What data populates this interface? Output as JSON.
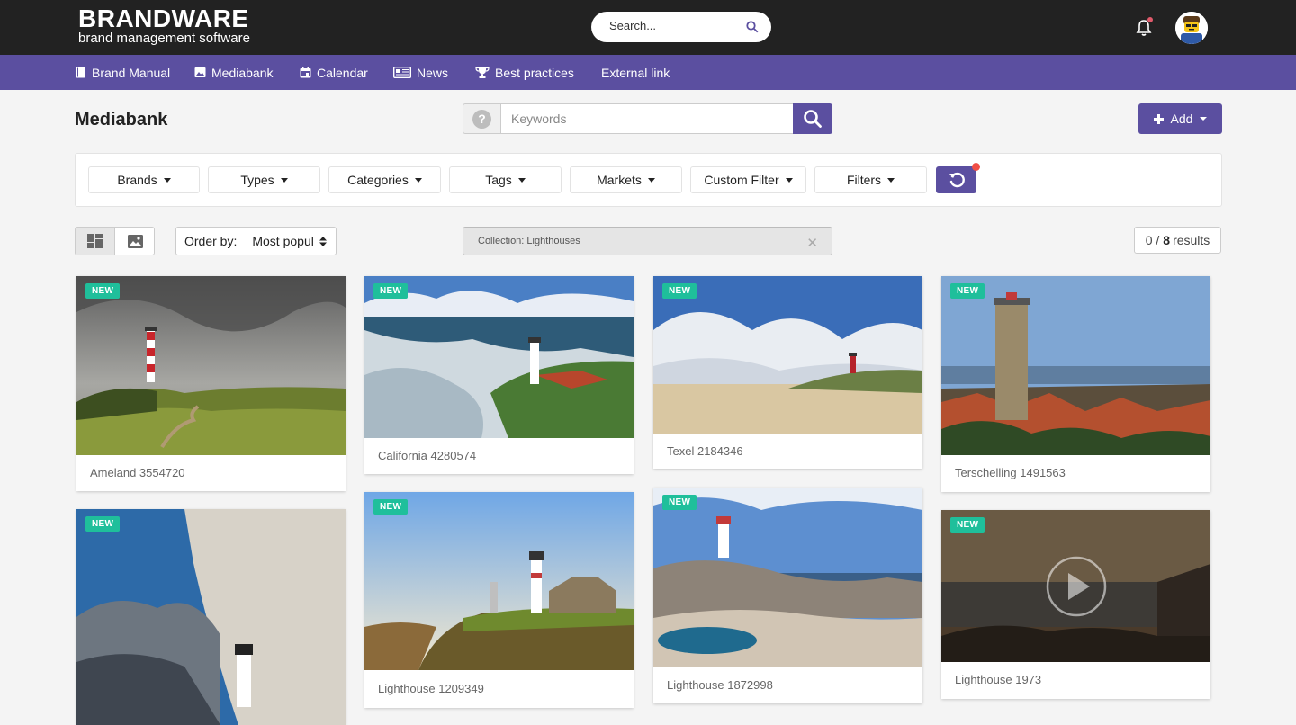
{
  "header": {
    "logo_brand": "BRANDWARE",
    "logo_sub": "brand management software",
    "search_placeholder": "Search..."
  },
  "nav": [
    {
      "label": "Brand Manual",
      "icon": "book-icon"
    },
    {
      "label": "Mediabank",
      "icon": "image-icon"
    },
    {
      "label": "Calendar",
      "icon": "calendar-icon"
    },
    {
      "label": "News",
      "icon": "newspaper-icon"
    },
    {
      "label": "Best practices",
      "icon": "trophy-icon"
    },
    {
      "label": "External link",
      "icon": ""
    }
  ],
  "page": {
    "title": "Mediabank",
    "keywords_placeholder": "Keywords",
    "help_label": "?",
    "add_label": "Add"
  },
  "filters": [
    "Brands",
    "Types",
    "Categories",
    "Tags",
    "Markets",
    "Custom Filter",
    "Filters"
  ],
  "toolbar": {
    "order_label": "Order by:",
    "order_value": "Most popul",
    "collection_tag": "Collection: Lighthouses",
    "results_selected": "0 /",
    "results_total": "8",
    "results_word": "results"
  },
  "cards": [
    {
      "title": "Ameland 3554720",
      "badge": "NEW"
    },
    {
      "title": "California 4280574",
      "badge": "NEW"
    },
    {
      "title": "Texel 2184346",
      "badge": "NEW"
    },
    {
      "title": "Terschelling 1491563",
      "badge": "NEW"
    },
    {
      "title": "",
      "badge": "NEW"
    },
    {
      "title": "Lighthouse 1209349",
      "badge": "NEW"
    },
    {
      "title": "Lighthouse 1872998",
      "badge": "NEW"
    },
    {
      "title": "Lighthouse 1973",
      "badge": "NEW",
      "video": true
    }
  ],
  "colors": {
    "topbar": "#222222",
    "navbar": "#5b4fa0",
    "accent": "#5b4fa0",
    "badge": "#1fbf9b",
    "notification": "#f04e45"
  }
}
